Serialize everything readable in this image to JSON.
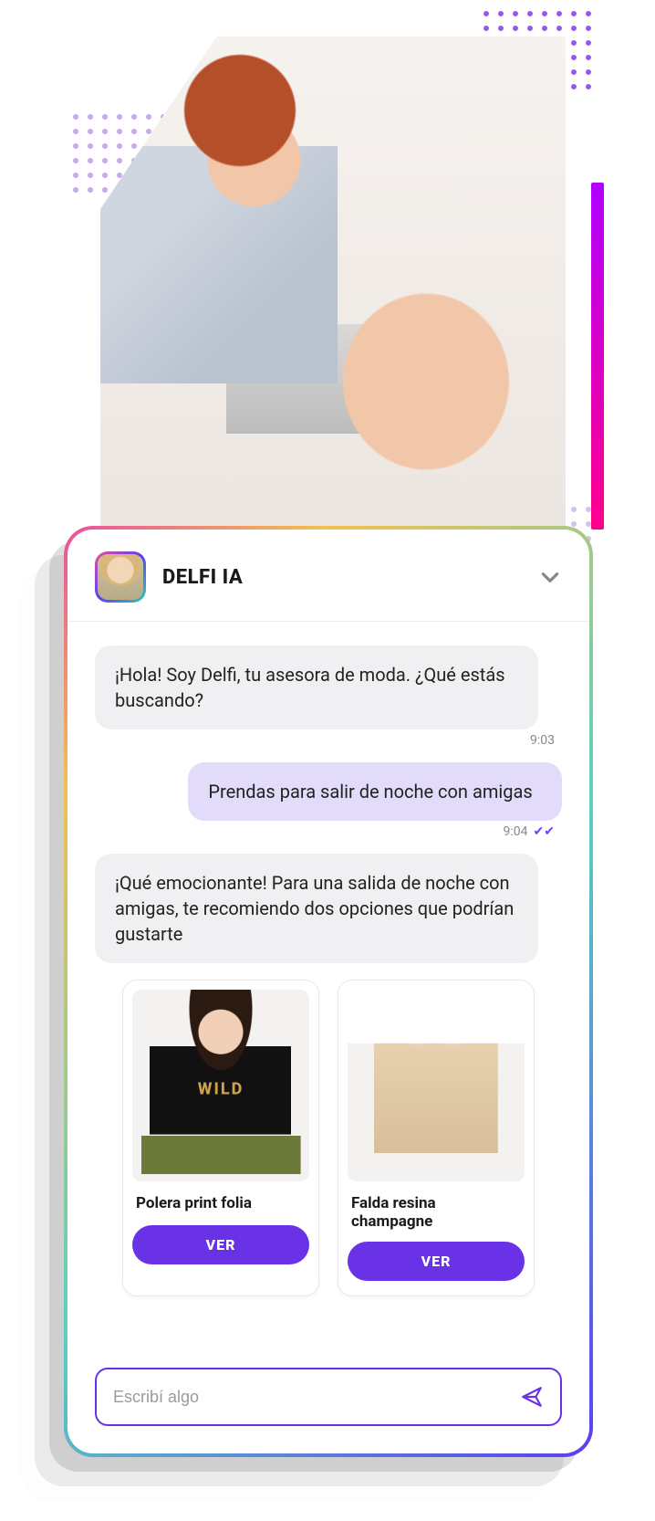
{
  "header": {
    "title": "DELFI IA"
  },
  "messages": [
    {
      "from": "bot",
      "text": "¡Hola! Soy Delfi, tu asesora de moda. ¿Qué estás buscando?",
      "time": "9:03"
    },
    {
      "from": "user",
      "text": "Prendas para salir de noche con amigas",
      "time": "9:04"
    },
    {
      "from": "bot",
      "text": "¡Qué emocionante! Para una salida de noche con amigas, te recomiendo dos opciones que podrían gustarte",
      "time": ""
    }
  ],
  "products": [
    {
      "title": "Polera print folia",
      "cta": "VER"
    },
    {
      "title": "Falda resina champagne",
      "cta": "VER"
    }
  ],
  "input": {
    "placeholder": "Escribí algo"
  }
}
